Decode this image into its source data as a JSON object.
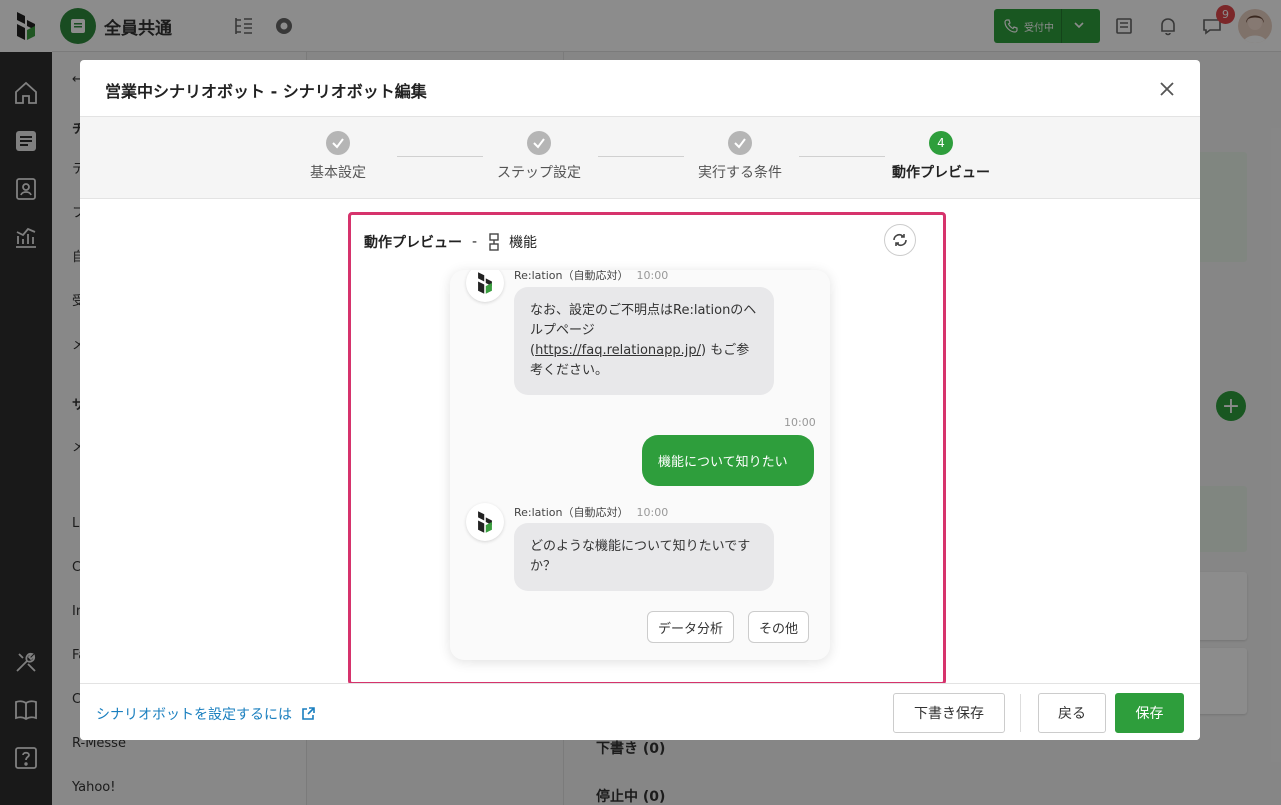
{
  "app": {
    "inbox_title": "全員共通",
    "phone_status": "受付中",
    "notification_count": "9"
  },
  "left_panel": {
    "items": [
      {
        "label": "チ"
      },
      {
        "label": "テ"
      },
      {
        "label": "フ"
      },
      {
        "label": "自"
      },
      {
        "label": "受"
      },
      {
        "label": "メ"
      },
      {
        "label": "サ"
      },
      {
        "label": "メ"
      },
      {
        "label": "L"
      },
      {
        "label": "C"
      },
      {
        "label": "In"
      },
      {
        "label": "Fa"
      },
      {
        "label": "C"
      },
      {
        "label": "R-Messe"
      },
      {
        "label": "Yahoo!"
      }
    ]
  },
  "right_panel": {
    "drafts_label": "下書き (0)",
    "stopped_label": "停止中 (0)"
  },
  "modal": {
    "title": "営業中シナリオボット - シナリオボット編集",
    "steps": [
      {
        "number": "1",
        "label": "基本設定",
        "state": "done"
      },
      {
        "number": "2",
        "label": "ステップ設定",
        "state": "done"
      },
      {
        "number": "3",
        "label": "実行する条件",
        "state": "done"
      },
      {
        "number": "4",
        "label": "動作プレビュー",
        "state": "current"
      }
    ],
    "preview": {
      "title": "動作プレビュー",
      "separator": "-",
      "subtitle": "機能",
      "bot_name": "Re:lation（自動応対）",
      "messages": {
        "bot1_time": "10:00",
        "bot1_text_a": "なお、設定のご不明点はRe:lationのヘルプページ (",
        "bot1_link": "https://faq.relationapp.jp/",
        "bot1_text_b": ") もご参考ください。",
        "user_time": "10:00",
        "user_text": "機能について知りたい",
        "bot2_time": "10:00",
        "bot2_text": "どのような機能について知りたいですか？"
      },
      "choices": [
        "データ分析",
        "その他"
      ]
    },
    "footer": {
      "help_link": "シナリオボットを設定するには",
      "draft_save": "下書き保存",
      "back": "戻る",
      "save": "保存"
    }
  }
}
